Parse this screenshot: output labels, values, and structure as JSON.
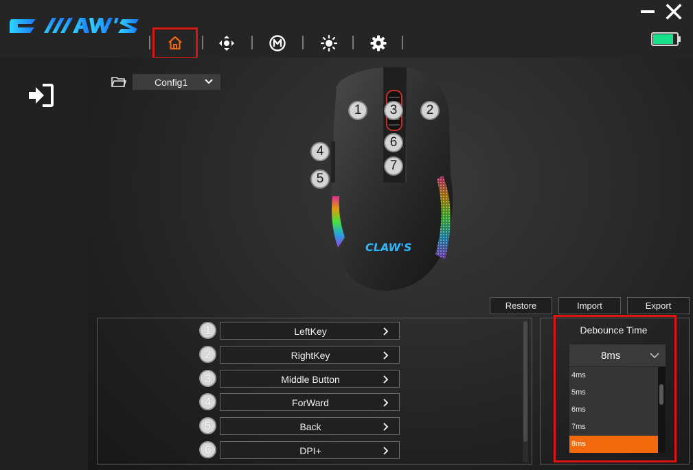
{
  "app": {
    "logo_text": "CLAW'S"
  },
  "nav": {
    "items": [
      {
        "name": "home",
        "icon": "home-icon",
        "active": true
      },
      {
        "name": "dpi",
        "icon": "move-arrows-icon"
      },
      {
        "name": "macro",
        "icon": "macro-m-icon"
      },
      {
        "name": "lighting",
        "icon": "sun-icon"
      },
      {
        "name": "settings",
        "icon": "gear-icon"
      }
    ],
    "accent_color": "#f26a0d",
    "highlight_color": "#e01212"
  },
  "battery": {
    "level_fraction": 0.85,
    "color": "#18e08a"
  },
  "config": {
    "selected": "Config1"
  },
  "mouse": {
    "logo_text": "CLAW'S",
    "markers": [
      "1",
      "2",
      "3",
      "4",
      "5",
      "6",
      "7"
    ]
  },
  "actions": {
    "restore": "Restore",
    "import": "Import",
    "export": "Export"
  },
  "keys": [
    {
      "num": "1",
      "label": "LeftKey"
    },
    {
      "num": "2",
      "label": "RightKey"
    },
    {
      "num": "3",
      "label": "Middle Button"
    },
    {
      "num": "4",
      "label": "ForWard"
    },
    {
      "num": "5",
      "label": "Back"
    },
    {
      "num": "6",
      "label": "DPI+"
    }
  ],
  "debounce": {
    "title": "Debounce Time",
    "selected": "8ms",
    "options": [
      "4ms",
      "5ms",
      "6ms",
      "7ms",
      "8ms"
    ]
  }
}
